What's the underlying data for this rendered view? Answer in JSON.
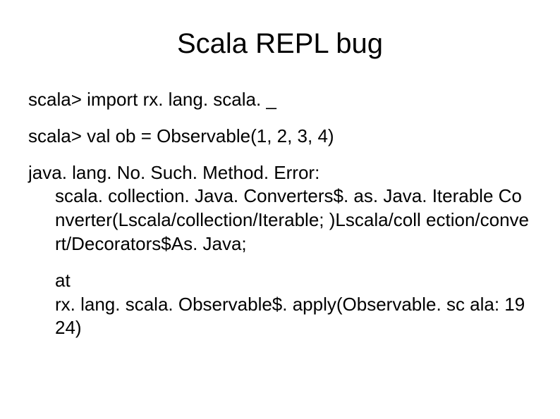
{
  "title": "Scala REPL bug",
  "lines": {
    "import": "scala> import rx. lang. scala. _",
    "val": "scala> val ob = Observable(1, 2, 3, 4)"
  },
  "error": {
    "header": "java. lang. No. Such. Method. Error:",
    "body": "scala. collection. Java. Converters$. as. Java. Iterable Converter(Lscala/collection/Iterable; )Lscala/coll ection/convert/Decorators$As. Java;"
  },
  "stack": {
    "at": "at",
    "detail": "rx. lang. scala. Observable$. apply(Observable. sc ala: 1924)"
  }
}
